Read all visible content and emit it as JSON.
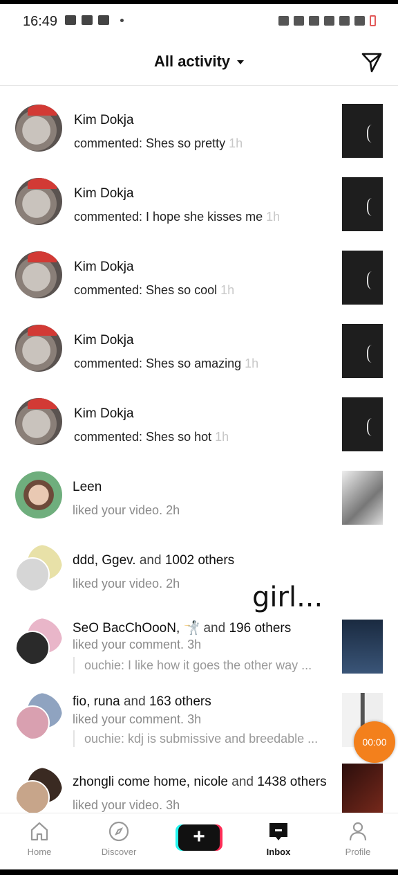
{
  "status_bar": {
    "time": "16:49"
  },
  "header": {
    "title": "All activity"
  },
  "activities": [
    {
      "name": "Kim Dokja",
      "text": "commented: Shes so pretty",
      "time": "1h"
    },
    {
      "name": "Kim Dokja",
      "text": "commented: I hope she kisses me",
      "time": "1h"
    },
    {
      "name": "Kim Dokja",
      "text": "commented: Shes so cool",
      "time": "1h"
    },
    {
      "name": "Kim Dokja",
      "text": "commented: Shes so amazing",
      "time": "1h"
    },
    {
      "name": "Kim Dokja",
      "text": "commented: Shes so hot",
      "time": "1h"
    },
    {
      "name": "Leen",
      "text": "liked your video.",
      "time": "2h"
    },
    {
      "name_a": "ddd",
      "name_b": "Ggev.",
      "and": "and",
      "count": "1002 others",
      "text": "liked your video.",
      "time": "2h"
    },
    {
      "name_a": "SeO BacChOooN",
      "name_b": "🤺",
      "and": "and",
      "count": "196 others",
      "text": "liked your comment.",
      "time": "3h",
      "quote": "ouchie: I like how it goes the other way ..."
    },
    {
      "name_a": "fio",
      "name_b": "runa",
      "and": "and",
      "count": "163 others",
      "text": "liked your comment.",
      "time": "3h",
      "quote": "ouchie: kdj is submissive and breedable ..."
    },
    {
      "name_a": "zhongli come home",
      "name_b": "nicole",
      "and": "and",
      "count": "1438 others",
      "text": "liked your video.",
      "time": "3h"
    }
  ],
  "overlay": {
    "caption": "girl...",
    "timer": "00:00"
  },
  "nav": {
    "home": "Home",
    "discover": "Discover",
    "add": "+",
    "inbox": "Inbox",
    "profile": "Profile"
  }
}
